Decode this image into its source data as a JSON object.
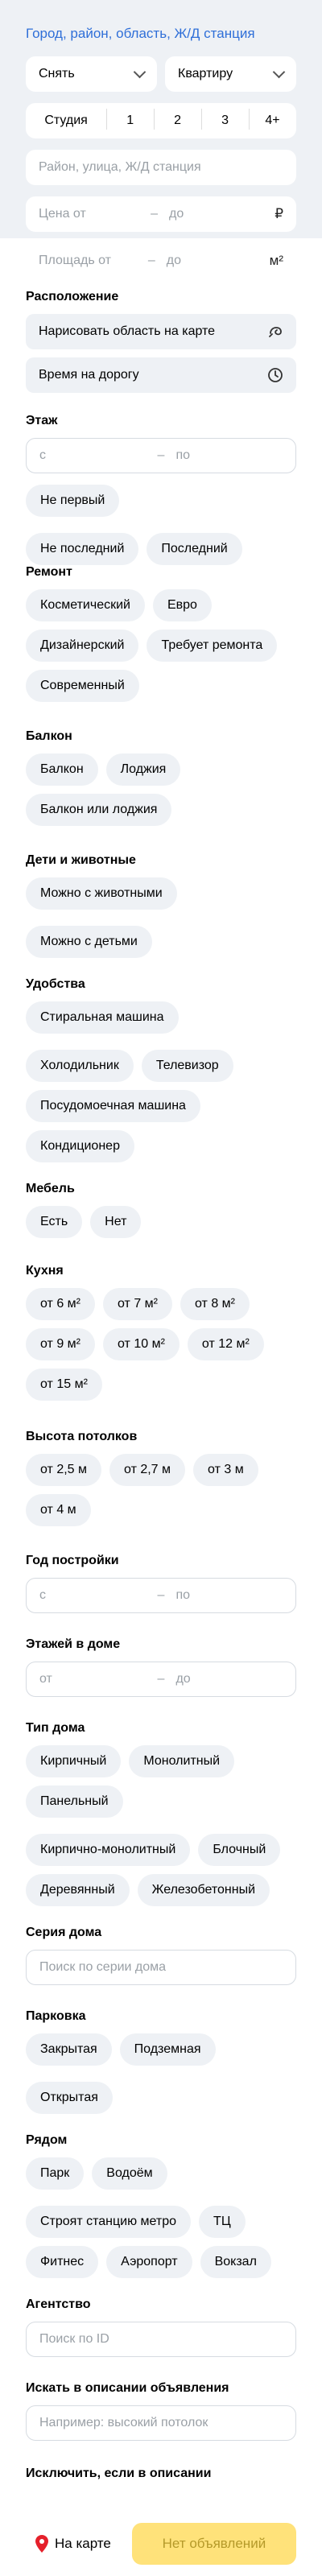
{
  "header": {
    "city_link": "Город, район, область, Ж/Д станция",
    "deal_select": "Снять",
    "type_select": "Квартиру",
    "rooms": [
      "Студия",
      "1",
      "2",
      "3",
      "4+"
    ],
    "address_placeholder": "Район, улица, Ж/Д станция",
    "price_from": "Цена от",
    "price_to": "до",
    "price_unit": "₽",
    "area_from": "Площадь от",
    "area_to": "до",
    "area_unit": "м²"
  },
  "location": {
    "title": "Расположение",
    "draw_area": "Нарисовать область на карте",
    "commute": "Время на дорогу"
  },
  "floor": {
    "title": "Этаж",
    "from": "с",
    "to": "по",
    "chips": [
      "Не первый",
      "Не последний",
      "Последний"
    ]
  },
  "repair": {
    "title": "Ремонт",
    "chips": [
      "Косметический",
      "Евро",
      "Дизайнерский",
      "Требует ремонта",
      "Современный"
    ]
  },
  "balcony": {
    "title": "Балкон",
    "chips": [
      "Балкон",
      "Лоджия",
      "Балкон или лоджия"
    ]
  },
  "kids_pets": {
    "title": "Дети и животные",
    "chips": [
      "Можно с животными",
      "Можно с детьми"
    ]
  },
  "amenities": {
    "title": "Удобства",
    "chips": [
      "Стиральная машина",
      "Холодильник",
      "Телевизор",
      "Посудомоечная машина",
      "Кондиционер"
    ]
  },
  "furniture": {
    "title": "Мебель",
    "chips": [
      "Есть",
      "Нет"
    ]
  },
  "kitchen": {
    "title": "Кухня",
    "chips": [
      "от 6 м²",
      "от 7 м²",
      "от 8 м²",
      "от 9 м²",
      "от 10 м²",
      "от 12 м²",
      "от 15 м²"
    ]
  },
  "ceiling": {
    "title": "Высота потолков",
    "chips": [
      "от 2,5 м",
      "от 2,7 м",
      "от 3 м",
      "от 4 м"
    ]
  },
  "year": {
    "title": "Год постройки",
    "from": "с",
    "to": "по"
  },
  "floors_total": {
    "title": "Этажей в доме",
    "from": "от",
    "to": "до"
  },
  "house_type": {
    "title": "Тип дома",
    "chips": [
      "Кирпичный",
      "Монолитный",
      "Панельный",
      "Кирпично-монолитный",
      "Блочный",
      "Деревянный",
      "Железобетонный"
    ]
  },
  "series": {
    "title": "Серия дома",
    "placeholder": "Поиск по серии дома"
  },
  "parking": {
    "title": "Парковка",
    "chips": [
      "Закрытая",
      "Подземная",
      "Открытая"
    ]
  },
  "nearby": {
    "title": "Рядом",
    "chips": [
      "Парк",
      "Водоём",
      "Строят станцию метро",
      "ТЦ",
      "Фитнес",
      "Аэропорт",
      "Вокзал"
    ]
  },
  "agency": {
    "title": "Агентство",
    "placeholder": "Поиск по ID"
  },
  "description": {
    "title": "Искать в описании объявления",
    "placeholder": "Например: высокий потолок"
  },
  "exclude": {
    "title": "Исключить, если в описании"
  },
  "bottom": {
    "map_button": "На карте",
    "results_button": "Нет объявлений"
  }
}
